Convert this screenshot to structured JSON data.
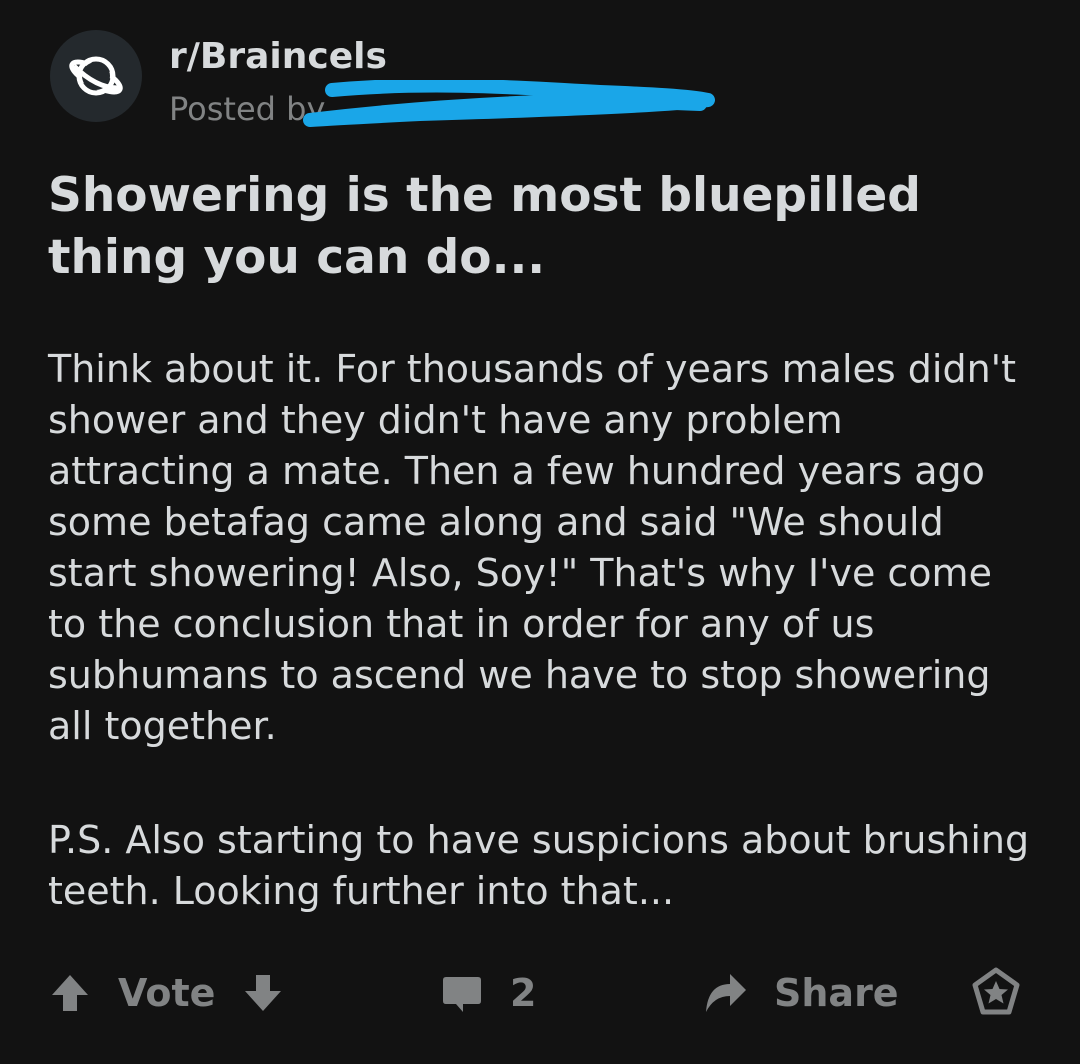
{
  "post": {
    "subreddit": "r/Braincels",
    "posted_by": "Posted by",
    "title": "Showering is the most bluepilled thing you can do...",
    "body": [
      "Think about it. For thousands of years males didn't shower and they didn't have any problem attracting a mate. Then a few hundred years ago some betafag came along and said \"We should start showering! Also, Soy!\" That's why I've come to the conclusion that in order for any of us subhumans to ascend we have to stop showering all together.",
      "P.S. Also starting to have suspicions about brushing teeth. Looking further into that..."
    ]
  },
  "actions": {
    "vote_label": "Vote",
    "comment_count": "2",
    "share_label": "Share"
  },
  "icons": {
    "avatar": "planet-icon",
    "upvote": "arrow-up-icon",
    "downvote": "arrow-down-icon",
    "comments": "comment-bubble-icon",
    "share": "share-arrow-icon",
    "award": "award-icon"
  },
  "colors": {
    "background": "#121212",
    "text": "#d7dadc",
    "muted": "#818384",
    "redaction": "#1aa6e8"
  }
}
